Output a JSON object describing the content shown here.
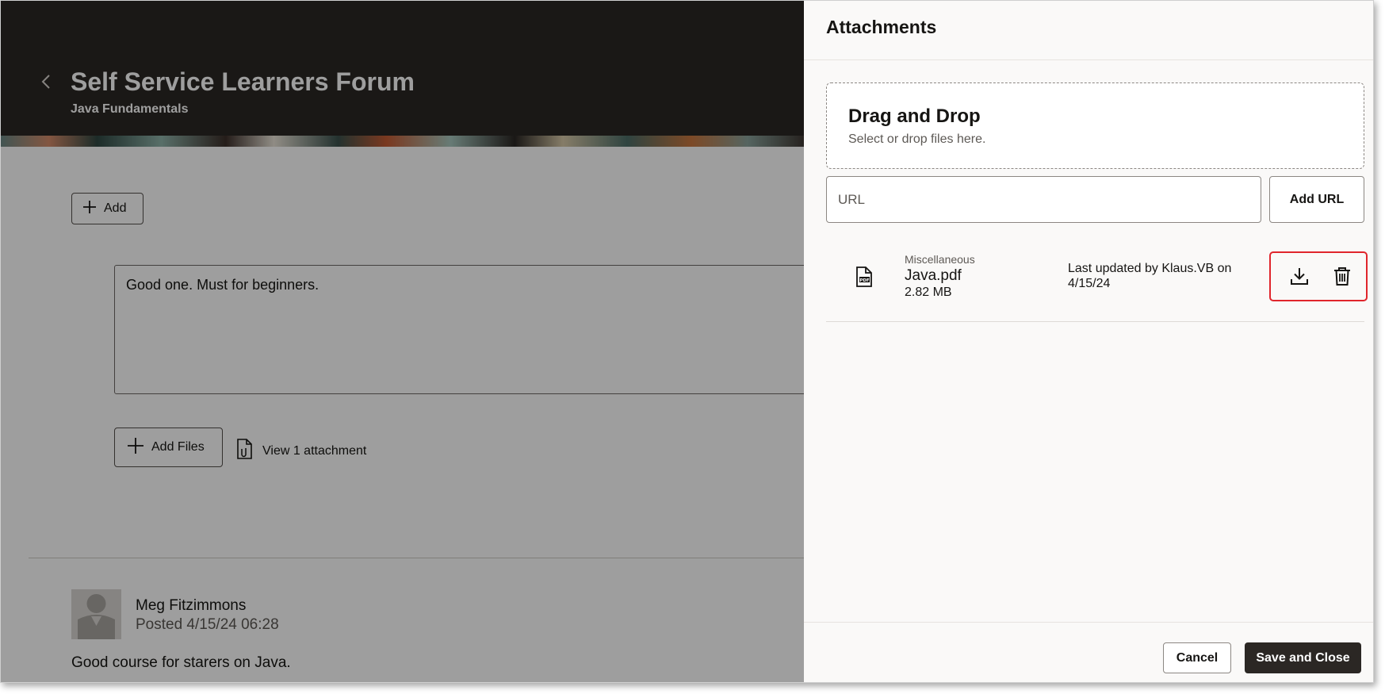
{
  "page": {
    "title": "Self Service Learners Forum",
    "subtitle": "Java Fundamentals",
    "add_label": "Add",
    "comment_text": "Good one. Must for beginners.",
    "add_files_label": "Add Files",
    "view_attachment_label": "View 1 attachment",
    "post": {
      "author": "Meg Fitzimmons",
      "posted": "Posted 4/15/24 06:28",
      "text": "Good course for starers on Java."
    }
  },
  "drawer": {
    "title": "Attachments",
    "dropzone": {
      "title": "Drag and Drop",
      "subtitle": "Select or drop files here."
    },
    "url_placeholder": "URL",
    "add_url_label": "Add URL",
    "attachment": {
      "category": "Miscellaneous",
      "name": "Java.pdf",
      "size": "2.82 MB",
      "updated": "Last updated by Klaus.VB on 4/15/24",
      "icon": "pdf-file-icon"
    },
    "cancel_label": "Cancel",
    "save_label": "Save and Close"
  },
  "colors": {
    "header_dark": "#2b2724",
    "primary_button": "#2b2724",
    "highlight": "#e0252c",
    "overlay": "rgba(0,0,0,0.38)"
  }
}
